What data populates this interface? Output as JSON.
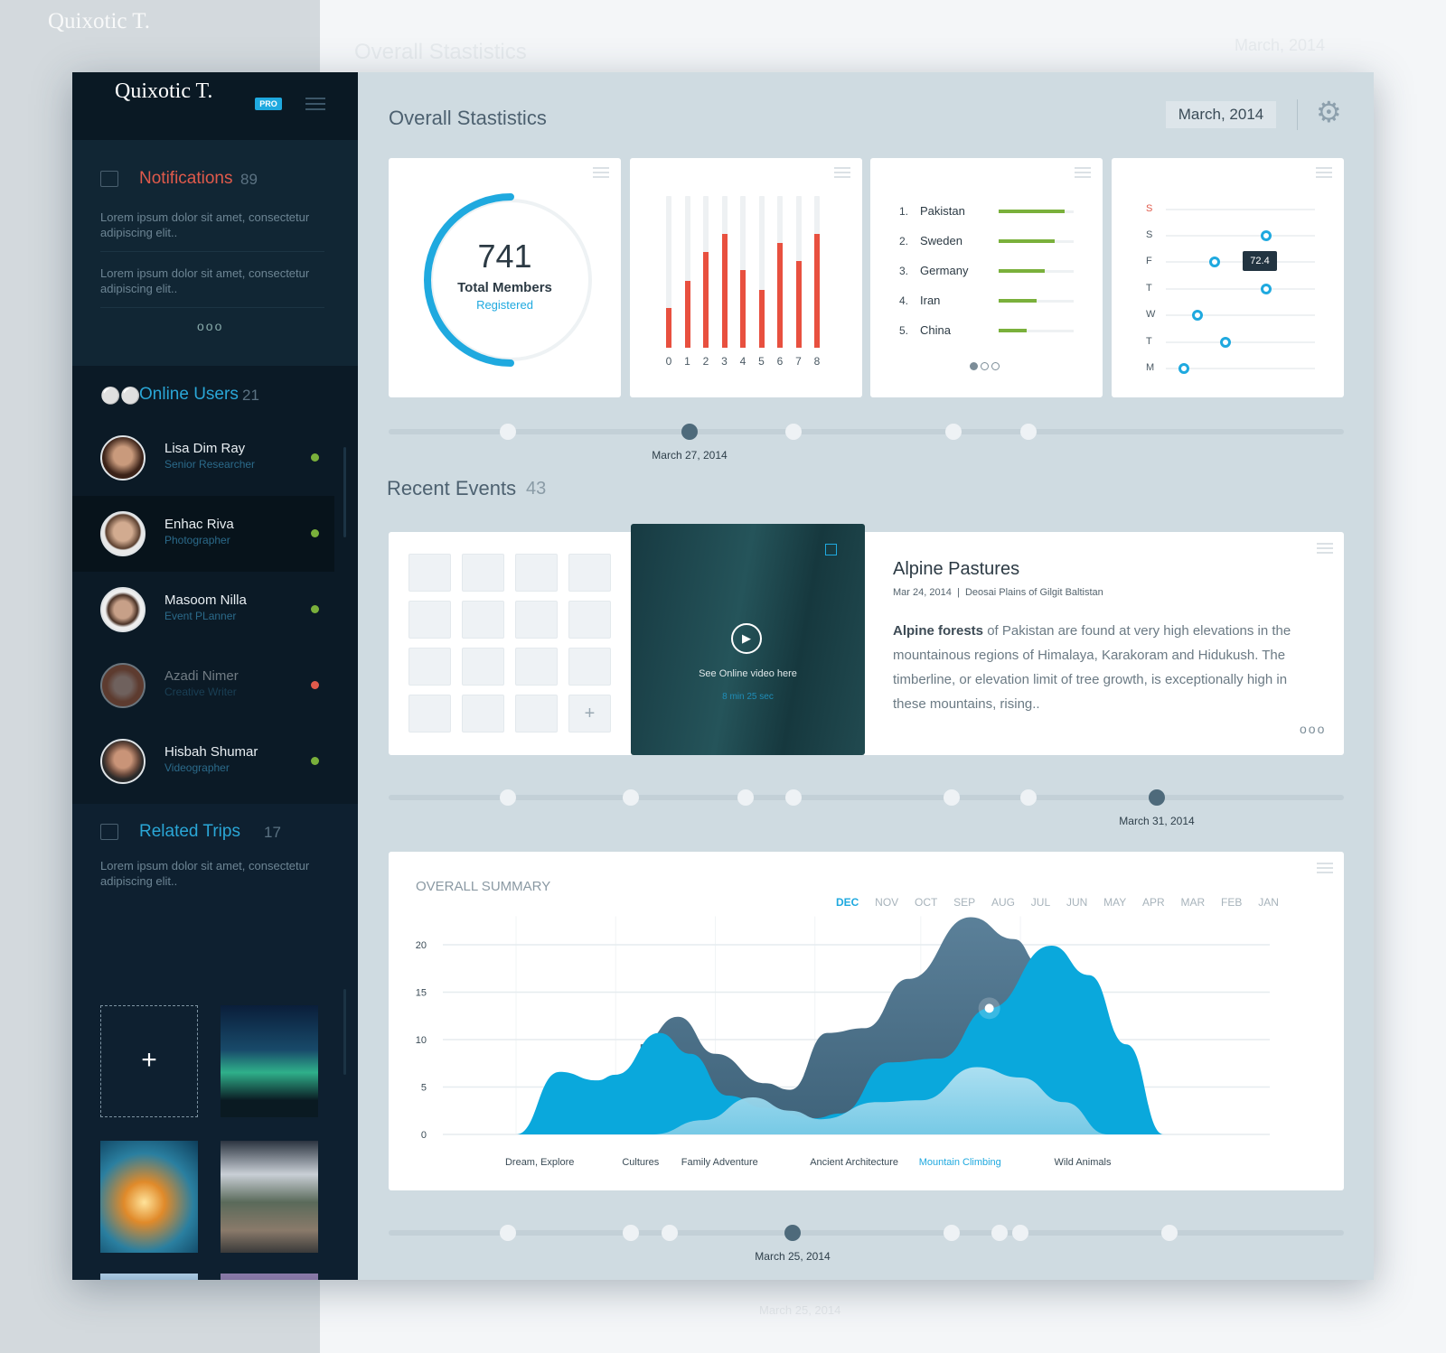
{
  "app": {
    "title": "Quixotic T.",
    "badge": "PRO"
  },
  "header": {
    "title": "Overall Stastistics",
    "date": "March, 2014"
  },
  "sidebar": {
    "notifications": {
      "title": "Notifications",
      "count": "89",
      "items": [
        "Lorem ipsum dolor sit amet, consectetur adipiscing elit..",
        "Lorem ipsum dolor sit amet, consectetur adipiscing elit.."
      ],
      "more": "ooo"
    },
    "online_users": {
      "title": "Online Users",
      "count": "21",
      "users": [
        {
          "name": "Lisa Dim Ray",
          "role": "Senior Researcher",
          "status": "online"
        },
        {
          "name": "Enhac Riva",
          "role": "Photographer",
          "status": "online"
        },
        {
          "name": "Masoom Nilla",
          "role": "Event PLanner",
          "status": "online"
        },
        {
          "name": "Azadi Nimer",
          "role": "Creative Writer",
          "status": "away"
        },
        {
          "name": "Hisbah Shumar",
          "role": "Videographer",
          "status": "online"
        }
      ]
    },
    "related_trips": {
      "title": "Related Trips",
      "count": "17",
      "text": "Lorem ipsum dolor sit amet, consectetur adipiscing elit..",
      "add": "+"
    }
  },
  "colors": {
    "accent": "#1fa9df",
    "notif": "#e05a4b",
    "online": "#7ab03b",
    "away": "#e05a4b",
    "bar": "#e8503f",
    "dark_area": "#4c7189",
    "mid_area": "#0aa8dc",
    "light_area": "#9fd8ec"
  },
  "stats": {
    "members": {
      "value": "741",
      "label": "Total Members",
      "sublabel": "Registered",
      "progress": 0.5
    },
    "bars": {
      "labels": [
        "0",
        "1",
        "2",
        "3",
        "4",
        "5",
        "6",
        "7",
        "8"
      ],
      "values": [
        0.26,
        0.44,
        0.63,
        0.75,
        0.51,
        0.38,
        0.69,
        0.57,
        0.75
      ]
    },
    "countries": [
      {
        "rank": "1.",
        "name": "Pakistan",
        "value": 0.88
      },
      {
        "rank": "2.",
        "name": "Sweden",
        "value": 0.75
      },
      {
        "rank": "3.",
        "name": "Germany",
        "value": 0.62
      },
      {
        "rank": "4.",
        "name": "Iran",
        "value": 0.5
      },
      {
        "rank": "5.",
        "name": "China",
        "value": 0.37
      }
    ],
    "days": [
      {
        "label": "S",
        "value": null
      },
      {
        "label": "S",
        "value": 0.67
      },
      {
        "label": "F",
        "value": 0.33
      },
      {
        "label": "T",
        "value": 0.67
      },
      {
        "label": "W",
        "value": 0.21
      },
      {
        "label": "T",
        "value": 0.4
      },
      {
        "label": "M",
        "value": 0.12
      }
    ],
    "tooltip": "72.4"
  },
  "timeline1": {
    "label": "March 27, 2014"
  },
  "events": {
    "title": "Recent Events",
    "count": "43",
    "add": "+",
    "video": {
      "caption": "See Online video here",
      "duration": "8 min 25 sec"
    },
    "item": {
      "title": "Alpine Pastures",
      "date": "Mar 24, 2014",
      "sep": "|",
      "location": "Deosai Plains of Gilgit Baltistan",
      "lead": "Alpine forests",
      "body": " of Pakistan are found at very high elevations in the mountainous regions of Himalaya, Karakoram and Hidukush. The timberline, or elevation limit of tree growth, is exceptionally high in these mountains, rising..",
      "more": "ooo"
    }
  },
  "timeline2": {
    "label": "March 31, 2014"
  },
  "timeline3": {
    "label": "March 25, 2014"
  },
  "chart_data": {
    "type": "area",
    "title": "OVERALL SUMMARY",
    "months": [
      "DEC",
      "NOV",
      "OCT",
      "SEP",
      "AUG",
      "JUL",
      "JUN",
      "MAY",
      "APR",
      "MAR",
      "FEB",
      "JAN"
    ],
    "selected_month": "DEC",
    "categories": [
      "Dream, Explore",
      "Cultures",
      "Family Adventure",
      "Ancient Architecture",
      "Mountain Climbing",
      "Wild Animals"
    ],
    "selected_category": "Mountain Climbing",
    "yticks": [
      0,
      5,
      10,
      15,
      20
    ],
    "ylim": [
      0,
      23
    ],
    "series": [
      {
        "points": [
          [
            2.0,
            9.5
          ],
          [
            2.6,
            12.4
          ],
          [
            3.2,
            8.5
          ],
          [
            4.0,
            5.4
          ],
          [
            4.4,
            4.7
          ],
          [
            5.0,
            10.7
          ],
          [
            5.6,
            11.2
          ],
          [
            6.3,
            16.4
          ],
          [
            7.3,
            22.9
          ],
          [
            8.0,
            20.6
          ],
          [
            8.4,
            18
          ],
          [
            8.8,
            11
          ],
          [
            9.3,
            0
          ]
        ]
      },
      {
        "points": [
          [
            0,
            0
          ],
          [
            0.7,
            6.6
          ],
          [
            1.3,
            5.7
          ],
          [
            1.6,
            6.3
          ],
          [
            2.3,
            10.7
          ],
          [
            2.8,
            8.5
          ],
          [
            3.4,
            4.1
          ],
          [
            4.0,
            2.8
          ],
          [
            4.8,
            1.7
          ],
          [
            5.2,
            2.2
          ],
          [
            6.0,
            7.6
          ],
          [
            6.8,
            8.0
          ],
          [
            7.6,
            13.3
          ],
          [
            8.6,
            19.9
          ],
          [
            9.2,
            16.8
          ],
          [
            9.8,
            9.5
          ],
          [
            10.4,
            0
          ]
        ]
      },
      {
        "points": [
          [
            2.2,
            0
          ],
          [
            3.0,
            1.5
          ],
          [
            3.8,
            3.9
          ],
          [
            4.4,
            2.5
          ],
          [
            4.9,
            1.6
          ],
          [
            5.8,
            3.4
          ],
          [
            6.5,
            3.6
          ],
          [
            7.4,
            7.1
          ],
          [
            8.1,
            6.0
          ],
          [
            8.8,
            3.4
          ],
          [
            9.5,
            0
          ]
        ]
      }
    ]
  }
}
